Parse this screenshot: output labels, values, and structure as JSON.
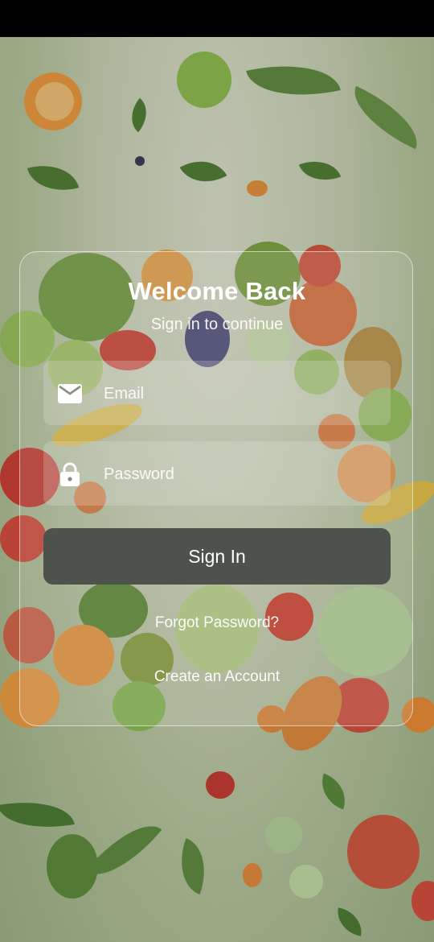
{
  "login": {
    "title": "Welcome Back",
    "subtitle": "Sign in to continue",
    "email": {
      "placeholder": "Email",
      "value": "",
      "icon": "mail-icon"
    },
    "password": {
      "placeholder": "Password",
      "value": "",
      "icon": "lock-icon"
    },
    "sign_in_label": "Sign In",
    "forgot_label": "Forgot Password?",
    "create_label": "Create an Account"
  },
  "colors": {
    "button": "#4d524c",
    "text": "#ffffff"
  }
}
